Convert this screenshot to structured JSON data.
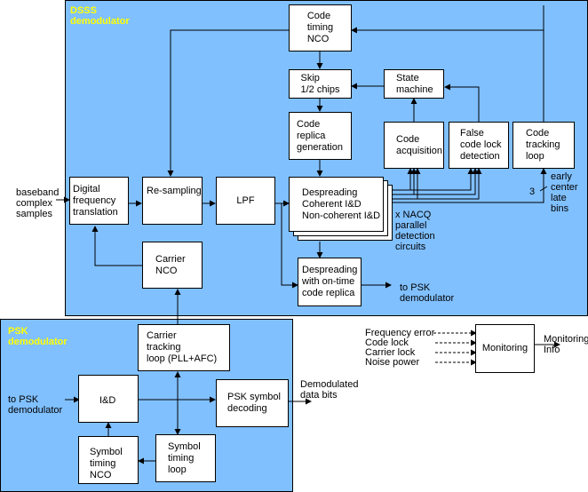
{
  "panels": {
    "dsss": {
      "title": "DSSS\ndemodulator",
      "color": "#80c0ff",
      "title_color": "#ffff00"
    },
    "psk": {
      "title": "PSK\ndemodulator",
      "color": "#80c0ff",
      "title_color": "#ffff00"
    }
  },
  "blocks": {
    "code_timing_nco": "Code\ntiming\nNCO",
    "skip_chips": "Skip\n1/2 chips",
    "code_replica_generation": "Code\nreplica\ngeneration",
    "state_machine": "State\nmachine",
    "code_acquisition": "Code\nacquisition",
    "false_code_lock_detection": "False\ncode lock\ndetection",
    "code_tracking_loop": "Code\ntracking\nloop",
    "digital_frequency_translation": "Digital\nfrequency\ntranslation",
    "resampling": "Re-sampling",
    "lpf": "LPF",
    "despreading_bank": "Despreading\nCoherent I&D\nNon-coherent I&D",
    "carrier_nco": "Carrier\nNCO",
    "despreading_ontime": "Despreading\nwith on-time\ncode replica",
    "carrier_tracking_loop": "Carrier\ntracking\nloop (PLL+AFC)",
    "integrate_dump": "I&D",
    "psk_symbol_decoding": "PSK symbol\ndecoding",
    "symbol_timing_nco": "Symbol\ntiming\nNCO",
    "symbol_timing_loop": "Symbol\ntiming\nloop",
    "monitoring": "Monitoring"
  },
  "labels": {
    "baseband_input": "baseband\ncomplex\nsamples",
    "nacq_note": "x NACQ\nparallel\ndetection\ncircuits",
    "bins_count": "3",
    "bins_note": "early\ncenter\nlate\nbins",
    "to_psk_out": "to PSK\ndemodulator",
    "to_psk_in": "to PSK\ndemodulator",
    "demod_bits": "Demodulated\ndata bits",
    "monitoring_inputs": [
      "Frequency error",
      "Code lock",
      "Carrier lock",
      "Noise power"
    ],
    "monitoring_output": "Monitoring\nInfo"
  }
}
